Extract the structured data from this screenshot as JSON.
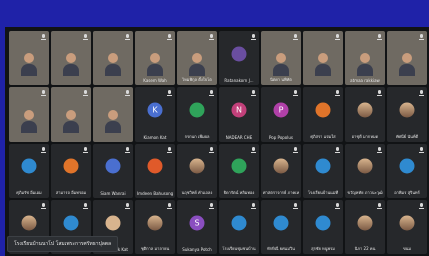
{
  "colors": {
    "frame": "#1f22a8",
    "background": "#111315",
    "tile": "#26282b"
  },
  "tiles": [
    {
      "name": "",
      "type": "video",
      "style": "vid-a"
    },
    {
      "name": "",
      "type": "video",
      "style": "vid-b"
    },
    {
      "name": "",
      "type": "video",
      "style": "vid-c"
    },
    {
      "name": "Kasem Wah",
      "type": "video",
      "style": "vid-d"
    },
    {
      "name": "ไหมพิกุล ตั้งใจโต",
      "type": "video",
      "style": "vid-e"
    },
    {
      "name": "Ratanakorn J...",
      "type": "avatar",
      "initial": "",
      "avatar_color": "#6a4ea0"
    },
    {
      "name": "นิตยา นพิทัต",
      "type": "video",
      "style": "vid-f"
    },
    {
      "name": "",
      "type": "video",
      "style": "vid-g"
    },
    {
      "name": "atmaa rakkiaw",
      "type": "video",
      "style": "vid-h"
    },
    {
      "name": "",
      "type": "video",
      "style": "vid-i"
    },
    {
      "name": "",
      "type": "video",
      "style": "vid-j"
    },
    {
      "name": "",
      "type": "video",
      "style": "vid-k"
    },
    {
      "name": "",
      "type": "video",
      "style": "vid-b"
    },
    {
      "name": "Kiamon Kat",
      "type": "avatar",
      "initial": "K",
      "avatar_color": "#4a6fd0"
    },
    {
      "name": "กรกนก เพิ่มผล",
      "type": "avatar",
      "initial": "",
      "avatar_color": "#2fa35a"
    },
    {
      "name": "NADEAR CHE",
      "type": "avatar",
      "initial": "N",
      "avatar_color": "#c2407a"
    },
    {
      "name": "Pop Popolus",
      "type": "avatar",
      "initial": "P",
      "avatar_color": "#b040a8"
    },
    {
      "name": "ศุภิสรา แจ่มใส",
      "type": "avatar",
      "initial": "",
      "avatar_color": "#e0742a"
    },
    {
      "name": "อาชุดี มากหมด",
      "type": "avatar",
      "photo": true
    },
    {
      "name": "ทัศนีย์ นันท์ดี",
      "type": "avatar",
      "photo": true
    },
    {
      "name": "ศุภิมรัช อิ่มเอม",
      "type": "avatar",
      "initial": "",
      "avatar_color": "#2f8ad0"
    },
    {
      "name": "สามารถ อิ่มทรอม",
      "type": "avatar",
      "initial": "",
      "avatar_color": "#e0742a"
    },
    {
      "name": "Siam Wanrai",
      "type": "avatar",
      "initial": "",
      "avatar_color": "#4a6fd0"
    },
    {
      "name": "Imdeen Bahusongi",
      "type": "avatar",
      "initial": "",
      "avatar_color": "#e05a2a"
    },
    {
      "name": "นฤชวิทย์ คำแถลง",
      "type": "avatar",
      "photo": true
    },
    {
      "name": "ธิดารัตน์ หลิมทอง",
      "type": "avatar",
      "initial": "",
      "avatar_color": "#2fa35a"
    },
    {
      "name": "ศาสตราจารย์ ภาคเหนือ",
      "type": "avatar",
      "photo": true
    },
    {
      "name": "โรงเรียนบ้านแม่ที",
      "type": "avatar",
      "initial": "",
      "avatar_color": "#2f8ad0"
    },
    {
      "name": "ขวัญหทัย ภาวนะวุฒิ",
      "type": "avatar",
      "photo": true
    },
    {
      "name": "อาพิมร สุรินทร์",
      "type": "avatar",
      "initial": "",
      "avatar_color": "#2f8ad0"
    },
    {
      "name": "",
      "type": "avatar",
      "photo": true
    },
    {
      "name": "",
      "type": "avatar",
      "initial": "",
      "avatar_color": "#2f8ad0"
    },
    {
      "name": "Rattanarak Kat",
      "type": "avatar",
      "initial": "",
      "avatar_color": "#d8b48e"
    },
    {
      "name": "ชุติกาล มาลายน",
      "type": "avatar",
      "photo": true
    },
    {
      "name": "Sukanya Potch",
      "type": "avatar",
      "initial": "S",
      "avatar_color": "#8a4ec0"
    },
    {
      "name": "โรงเรียนชุมชนบ้าน",
      "type": "avatar",
      "initial": "",
      "avatar_color": "#2f8ad0"
    },
    {
      "name": "ทักษิณี ยศแม่วิน",
      "type": "avatar",
      "initial": "",
      "avatar_color": "#2f8ad0"
    },
    {
      "name": "สุรชัย หนูพรม",
      "type": "avatar",
      "initial": "",
      "avatar_color": "#2f8ad0"
    },
    {
      "name": "นิภา 22 คน",
      "type": "avatar",
      "photo": true
    },
    {
      "name": "ขนม",
      "type": "avatar",
      "photo": true
    }
  ],
  "tooltip": "โรงเรียนบ้านนาโป โสมเพระการศรัทธาปุลตล"
}
